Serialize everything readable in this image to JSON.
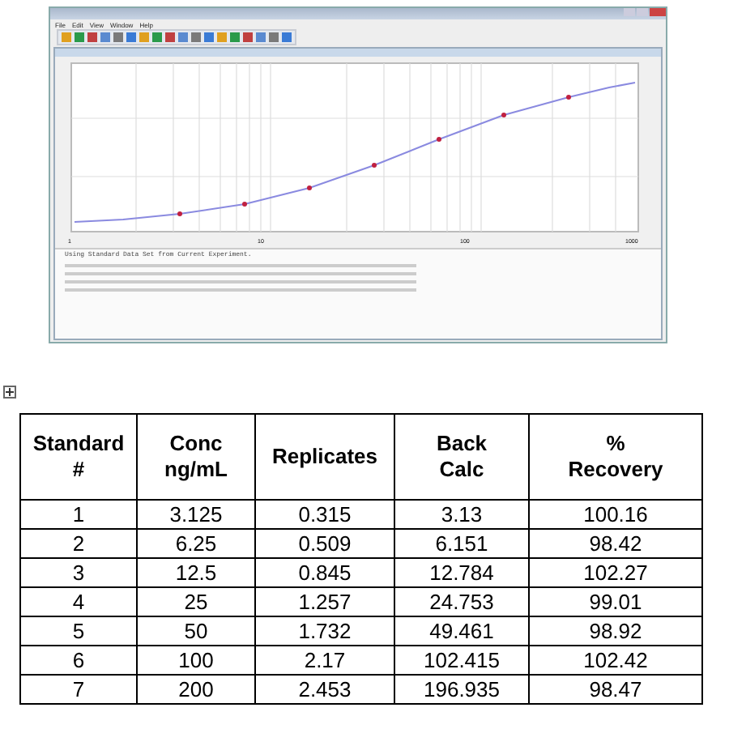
{
  "embedded_window": {
    "menu": [
      "File",
      "Edit",
      "View",
      "Window",
      "Help"
    ],
    "plot": {
      "xticks": [
        "1",
        "10",
        "100",
        "1000"
      ]
    },
    "status_line": "Using Standard Data Set from Current Experiment."
  },
  "table": {
    "columns": [
      "Standard\n#",
      "Conc\nng/mL",
      "Replicates",
      "Back\nCalc",
      "%\nRecovery"
    ],
    "rows": [
      [
        "1",
        "3.125",
        "0.315",
        "3.13",
        "100.16"
      ],
      [
        "2",
        "6.25",
        "0.509",
        "6.151",
        "98.42"
      ],
      [
        "3",
        "12.5",
        "0.845",
        "12.784",
        "102.27"
      ],
      [
        "4",
        "25",
        "1.257",
        "24.753",
        "99.01"
      ],
      [
        "5",
        "50",
        "1.732",
        "49.461",
        "98.92"
      ],
      [
        "6",
        "100",
        "2.17",
        "102.415",
        "102.42"
      ],
      [
        "7",
        "200",
        "2.453",
        "196.935",
        "98.47"
      ]
    ]
  }
}
